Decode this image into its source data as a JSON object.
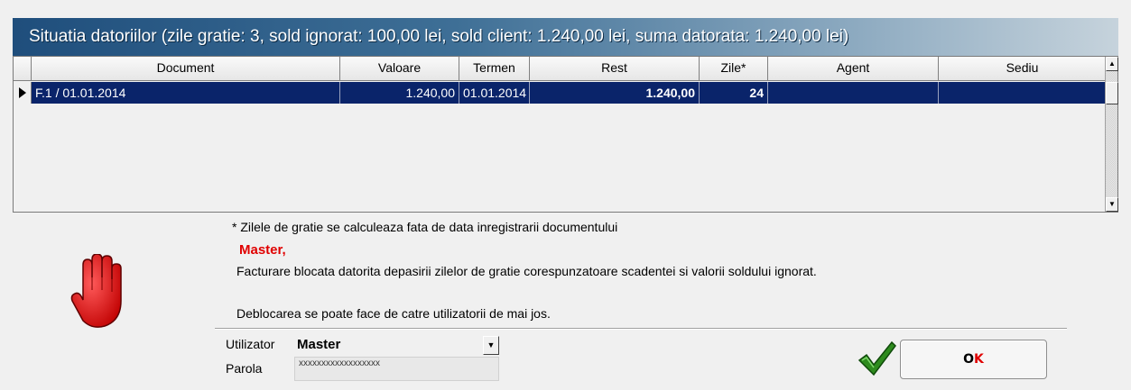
{
  "title": "Situatia datoriilor (zile gratie: 3, sold ignorat: 100,00 lei, sold client: 1.240,00 lei, suma datorata: 1.240,00 lei)",
  "table": {
    "columns": [
      "Document",
      "Valoare",
      "Termen",
      "Rest",
      "Zile*",
      "Agent",
      "Sediu"
    ],
    "rows": [
      {
        "document": "F.1 / 01.01.2014",
        "valoare": "1.240,00",
        "termen": "01.01.2014",
        "rest": "1.240,00",
        "zile": "24",
        "agent": "",
        "sediu": ""
      }
    ]
  },
  "note": "* Zilele de gratie se calculeaza fata de data inregistrarii documentului",
  "user_greeting": "Master,",
  "message": "Facturare blocata datorita depasirii zilelor de gratie corespunzatoare scadentei si valorii soldului ignorat.",
  "unlock_text": "Deblocarea se poate face de catre utilizatorii de mai jos.",
  "form": {
    "user_label": "Utilizator",
    "user_value": "Master",
    "password_label": "Parola",
    "password_value": "xxxxxxxxxxxxxxxxxx"
  },
  "ok_button": {
    "label_o": "O",
    "label_k": "K"
  },
  "colors": {
    "selection": "#0a246a",
    "accent_red": "#e00000",
    "check_green": "#2e8b1e"
  },
  "icons": [
    "stop-hand-icon",
    "checkmark-icon",
    "row-pointer-icon",
    "scroll-up-icon",
    "scroll-down-icon",
    "dropdown-arrow-icon"
  ]
}
